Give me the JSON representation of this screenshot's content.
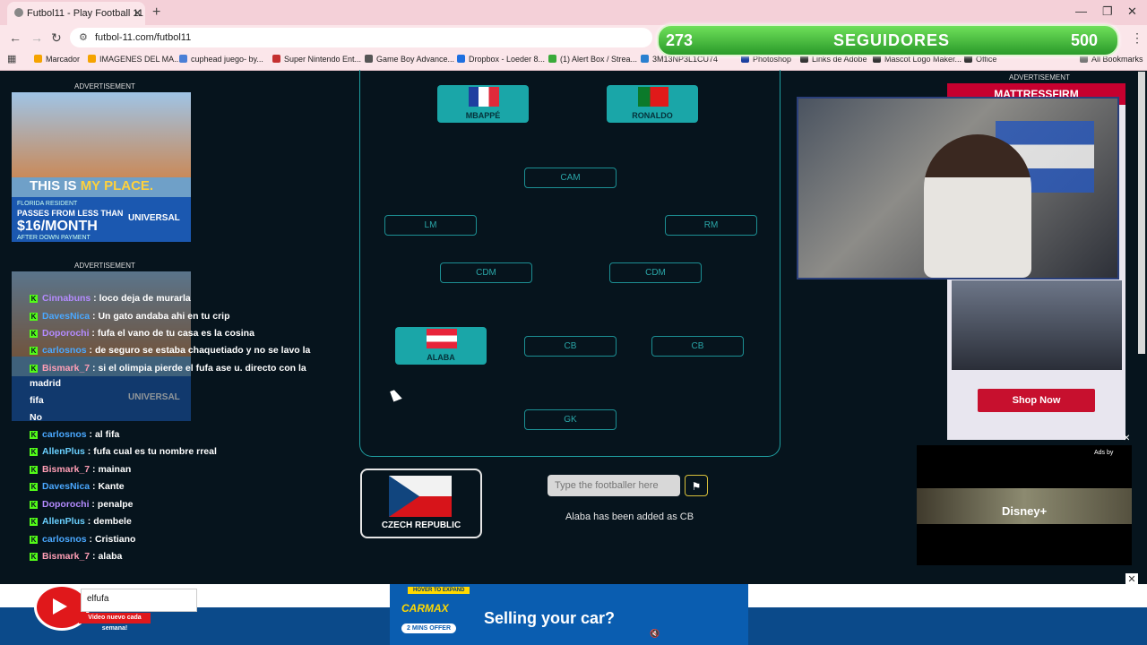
{
  "browser": {
    "tab_title": "Futbol11 - Play Football 11",
    "url": "futbol-11.com/futbol11",
    "bookmarks": [
      "Marcador",
      "IMAGENES DEL MA...",
      "cuphead juego- by...",
      "Super Nintendo Ent...",
      "Game Boy Advance...",
      "Dropbox - Loeder 8...",
      "(1) Alert Box / Strea...",
      "3M13NP3L1CU74",
      "Photoshop",
      "Links de Adobe",
      "Mascot Logo Maker...",
      "Office"
    ],
    "all_bookmarks": "All Bookmarks"
  },
  "followers": {
    "current": "273",
    "label": "SEGUIDORES",
    "goal": "500"
  },
  "ads": {
    "label": "ADVERTISEMENT",
    "left_ad": {
      "headline_a": "THIS IS ",
      "headline_b": "MY PLACE.",
      "resident": "FLORIDA RESIDENT",
      "passes": "PASSES FROM LESS THAN",
      "price": "$16/MONTH",
      "after": "AFTER DOWN PAYMENT",
      "brand": "UNIVERSAL"
    },
    "right_brand": "MATTRESSFIRM",
    "shop_now": "Shop Now",
    "ads_by": "Ads by",
    "disney": "Disney+"
  },
  "chat": [
    {
      "user": "Cinnabuns",
      "msg": "loco deja de murarla",
      "color": "#b48bff"
    },
    {
      "user": "DavesNica",
      "msg": "Un gato andaba ahi en tu crip",
      "color": "#4aa8ff"
    },
    {
      "user": "Doporochi",
      "msg": "fufa el vano de tu casa es la cosina",
      "color": "#b48bff"
    },
    {
      "user": "carlosnos",
      "msg": "de seguro se estaba chaquetiado y no se lavo la",
      "color": "#4aa8ff"
    },
    {
      "user": "Bismark_7",
      "msg": "si el olimpia pierde el fufa ase u. directo con la",
      "color": "#ff9eb5"
    },
    {
      "user": "",
      "msg": "madrid",
      "color": "#ffffff"
    },
    {
      "user": "",
      "msg": "fifa",
      "color": "#ffffff"
    },
    {
      "user": "",
      "msg": "No",
      "color": "#ffffff"
    },
    {
      "user": "carlosnos",
      "msg": "al fifa",
      "color": "#4aa8ff"
    },
    {
      "user": "AllenPlus",
      "msg": "fufa cual es tu nombre rreal",
      "color": "#6ad0ff"
    },
    {
      "user": "Bismark_7",
      "msg": "mainan",
      "color": "#ff9eb5"
    },
    {
      "user": "DavesNica",
      "msg": "Kante",
      "color": "#4aa8ff"
    },
    {
      "user": "Doporochi",
      "msg": "penalpe",
      "color": "#b48bff"
    },
    {
      "user": "AllenPlus",
      "msg": "dembele",
      "color": "#6ad0ff"
    },
    {
      "user": "carlosnos",
      "msg": "Cristiano",
      "color": "#4aa8ff"
    },
    {
      "user": "Bismark_7",
      "msg": "alaba",
      "color": "#ff9eb5"
    }
  ],
  "game": {
    "filled": [
      {
        "name": "MBAPPÉ",
        "flag": "france"
      },
      {
        "name": "RONALDO",
        "flag": "portugal"
      },
      {
        "name": "ALABA",
        "flag": "austria"
      }
    ],
    "slots": [
      "CAM",
      "LM",
      "RM",
      "CDM",
      "CDM",
      "CB",
      "CB",
      "GK"
    ],
    "nation": "CZECH REPUBLIC",
    "search_placeholder": "Type the footballer here",
    "status": "Alaba has been added as CB"
  },
  "bottom": {
    "channel": "elfufa",
    "video_tag": "Video nuevo cada semana!",
    "hover": "HOVER TO EXPAND",
    "carmax": "CARMAX",
    "mins": "2 MINS OFFER",
    "selling": "Selling your car?"
  }
}
